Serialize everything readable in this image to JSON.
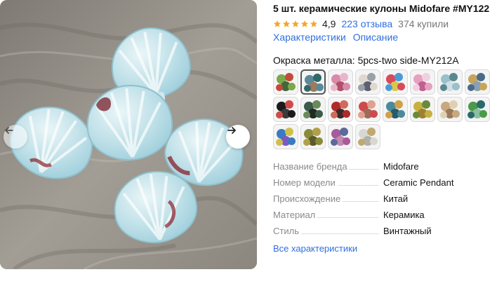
{
  "product": {
    "title": "5 шт. керамические кулоны Midofare #MY122",
    "rating": "4,9",
    "reviews": "223 отзыва",
    "bought": "374 купили",
    "tabs": [
      "Характеристики",
      "Описание"
    ],
    "option_label": "Окраска металла: 5pcs-two side-MY212A"
  },
  "gallery": {
    "prev_icon": "arrow-left-icon",
    "next_icon": "arrow-right-icon"
  },
  "swatch_palette": [
    [
      "#7aa84a",
      "#c24a3a",
      "#3e6a3a"
    ],
    [
      "#5a8a9a",
      "#2f6a6a",
      "#a07a5a"
    ],
    [
      "#d98aa8",
      "#e8b5c9",
      "#b0506a"
    ],
    [
      "#e0d8d0",
      "#9aa0a8",
      "#5a6070"
    ],
    [
      "#d84a5a",
      "#4a9ad8",
      "#d8c84a"
    ],
    [
      "#e8a0c0",
      "#f0d0e0",
      "#c06090"
    ],
    [
      "#9ac0c8",
      "#5a8890",
      "#d0e0e4"
    ],
    [
      "#c8a45a",
      "#4a6a8a",
      "#8aa0b0"
    ],
    [
      "#1a1a1a",
      "#d04a4a",
      "#3a3a3a"
    ],
    [
      "#3a5a4a",
      "#6a8a5a",
      "#222a24"
    ],
    [
      "#b02a2a",
      "#d06a5a",
      "#3a2a2a"
    ],
    [
      "#d04a4a",
      "#e0a090",
      "#a06a5a"
    ],
    [
      "#4a8a9a",
      "#d0a04a",
      "#2a5a6a"
    ],
    [
      "#c8b040",
      "#6a8a3a",
      "#a08030"
    ],
    [
      "#c8a880",
      "#e0d0b0",
      "#9a7a5a"
    ],
    [
      "#4a9a4a",
      "#2a6a6a",
      "#8ac0a0"
    ],
    [
      "#3a7ac0",
      "#d0c04a",
      "#7a5ac0"
    ],
    [
      "#8a8a3a",
      "#b0a04a",
      "#5a5a2a"
    ],
    [
      "#a85a9a",
      "#5a6a9a",
      "#c08ab0"
    ],
    [
      "#d8d8d0",
      "#c0a870",
      "#b0b0a8"
    ]
  ],
  "specs": [
    {
      "key": "Название бренда",
      "value": "Midofare"
    },
    {
      "key": "Номер модели",
      "value": "Ceramic Pendant"
    },
    {
      "key": "Происхождение",
      "value": "Китай"
    },
    {
      "key": "Материал",
      "value": "Керамика"
    },
    {
      "key": "Стиль",
      "value": "Винтажный"
    }
  ],
  "all_specs_link": "Все характеристики",
  "colors": {
    "link": "#2f6fe0",
    "star": "#f5a623",
    "muted": "#8a8a8a"
  }
}
